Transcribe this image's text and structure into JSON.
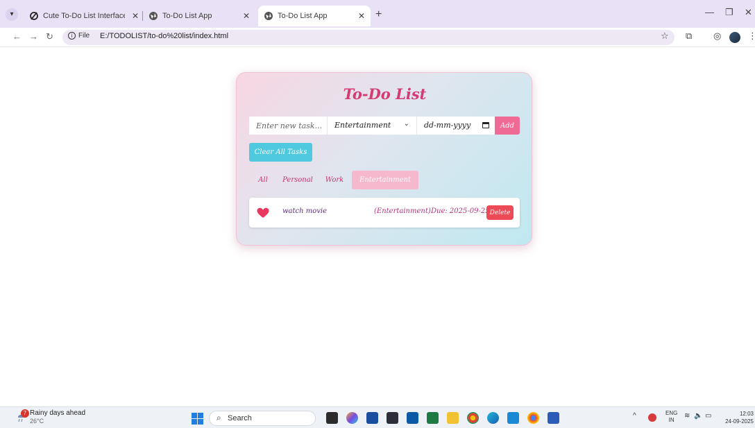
{
  "browser": {
    "tabs": [
      {
        "title": "Cute To-Do List Interface Desig",
        "active": false
      },
      {
        "title": "To-Do List App",
        "active": false
      },
      {
        "title": "To-Do List App",
        "active": true
      }
    ],
    "new_tab": "+",
    "address": {
      "chip": "File",
      "url": "E:/TODOLIST/to-do%20list/index.html"
    }
  },
  "app": {
    "title": "To-Do List",
    "task_input": {
      "placeholder": "Enter new task...",
      "value": ""
    },
    "category_select": {
      "selected": "Entertainment"
    },
    "date_input": {
      "value": "dd-mm-yyyy"
    },
    "add_label": "Add",
    "clear_label": "Clear All Tasks",
    "filters": [
      {
        "label": "All",
        "active": false
      },
      {
        "label": "Personal",
        "active": false
      },
      {
        "label": "Work",
        "active": false
      },
      {
        "label": "Entertainment",
        "active": true
      }
    ],
    "tasks": [
      {
        "icon": "heart-icon",
        "text": "watch movie",
        "category": "(Entertainment)",
        "due": "Due: 2025-09-25",
        "delete_label": "Delete"
      }
    ]
  },
  "taskbar": {
    "weather": {
      "title": "Rainy days ahead",
      "temp": "26°C",
      "badge": "7"
    },
    "search_label": "Search",
    "language": {
      "line1": "ENG",
      "line2": "IN"
    },
    "clock": {
      "time": "12:03",
      "date": "24-09-2025"
    }
  },
  "colors": {
    "accent_pink": "#ef6b96",
    "title_pink": "#d63a73",
    "clear_cyan": "#4fc9de",
    "delete_red": "#ec4a57",
    "filter_active": "#f6b8cd"
  }
}
